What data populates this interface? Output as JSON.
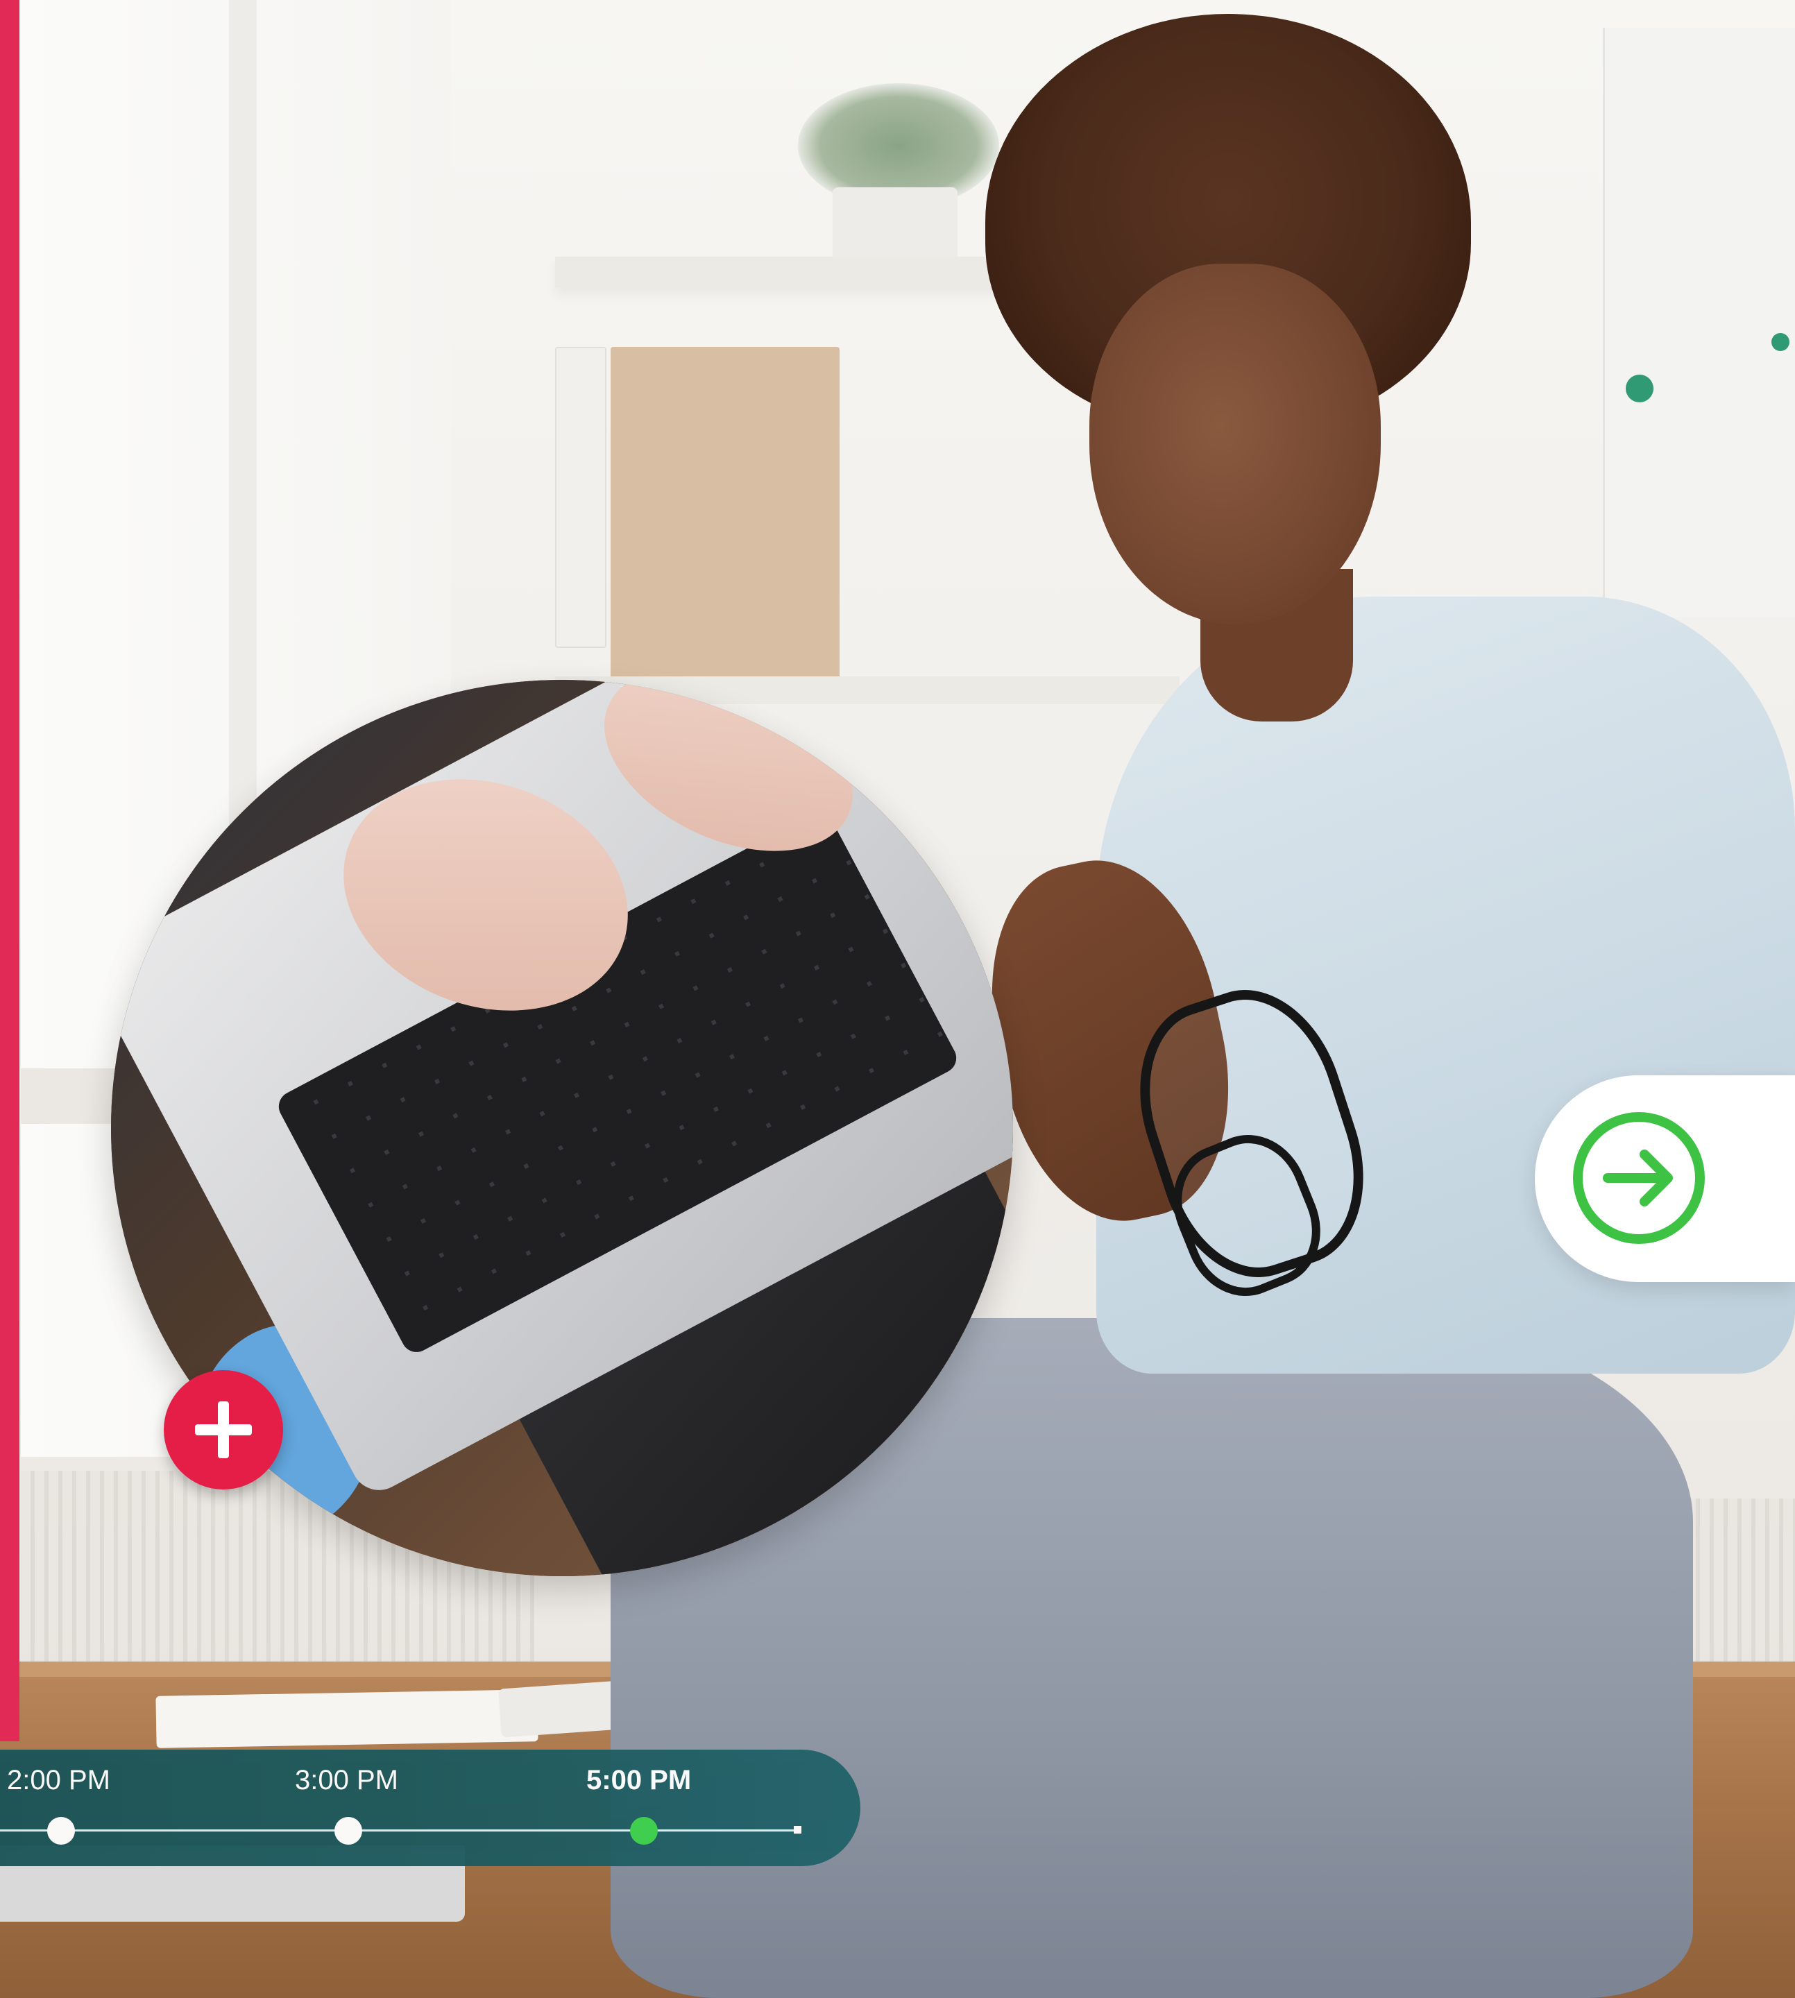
{
  "timeline": {
    "items": [
      {
        "label": "2:00 PM",
        "active": false
      },
      {
        "label": "3:00 PM",
        "active": false
      },
      {
        "label": "5:00 PM",
        "active": true
      }
    ]
  },
  "colors": {
    "accent_bar": "#e22a56",
    "plus_button": "#e51e48",
    "arrow_green": "#3ec244",
    "timeline_bg": "#1e5b5f",
    "timeline_active_dot": "#3ed14b"
  },
  "icons": {
    "plus": "plus-icon",
    "arrow": "arrow-right-circle-icon"
  }
}
